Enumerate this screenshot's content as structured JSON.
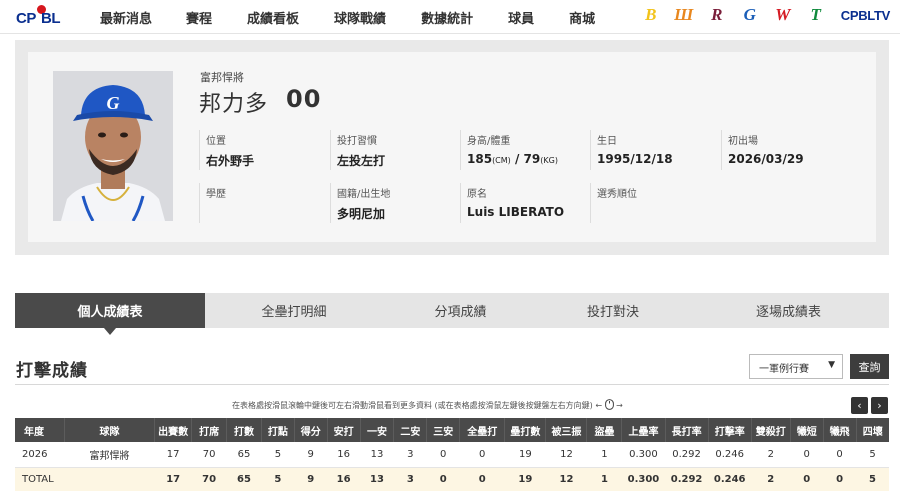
{
  "header": {
    "logo": {
      "cp": "CP",
      "bl": "BL"
    },
    "nav": [
      "最新消息",
      "賽程",
      "成績看板",
      "球隊戰績",
      "數據統計",
      "球員",
      "商城"
    ],
    "teams": [
      {
        "name": "brothers-logo",
        "glyph": "B",
        "color": "#f2c31a"
      },
      {
        "name": "lions-logo",
        "glyph": "Ш",
        "color": "#e8871e"
      },
      {
        "name": "rakuten-logo",
        "glyph": "R",
        "color": "#7a1e3a"
      },
      {
        "name": "fubon-logo",
        "glyph": "G",
        "color": "#1c5fb8"
      },
      {
        "name": "wei-chuan-logo",
        "glyph": "W",
        "color": "#d51b24"
      },
      {
        "name": "tsg-logo",
        "glyph": "T",
        "color": "#0f8a3c"
      }
    ],
    "tv_label": "CPBLTV"
  },
  "player": {
    "team": "富邦悍將",
    "name": "邦力多",
    "number": "00",
    "fields": [
      {
        "label": "位置",
        "value": "右外野手"
      },
      {
        "label": "投打習慣",
        "value": "左投左打"
      },
      {
        "label": "身高/體重",
        "value": "",
        "height": "185",
        "height_unit": "(CM)",
        "sep": " / ",
        "weight": "79",
        "weight_unit": "(KG)"
      },
      {
        "label": "生日",
        "value": "1995/12/18"
      },
      {
        "label": "初出場",
        "value": "2026/03/29"
      },
      {
        "label": "學歷",
        "value": ""
      },
      {
        "label": "國籍/出生地",
        "value": "多明尼加"
      },
      {
        "label": "原名",
        "value": "Luis LIBERATO"
      },
      {
        "label": "選秀順位",
        "value": ""
      }
    ]
  },
  "tabs": [
    "個人成績表",
    "全壘打明細",
    "分項成績",
    "投打對決",
    "逐場成績表"
  ],
  "section": {
    "title": "打擊成績",
    "select_value": "一軍例行賽",
    "query_label": "查詢",
    "hint": "在表格處按滑鼠滾輪中鍵後可左右滑動滑鼠看到更多資料 (或在表格處按滑鼠左鍵後按鍵盤左右方向鍵)",
    "pager_prev": "‹",
    "pager_next": "›"
  },
  "table": {
    "headers": [
      "年度",
      "球隊",
      "出賽數",
      "打席",
      "打數",
      "打點",
      "得分",
      "安打",
      "一安",
      "二安",
      "三安",
      "全壘打",
      "壘打數",
      "被三振",
      "盜壘",
      "上壘率",
      "長打率",
      "打擊率",
      "雙殺打",
      "犧短",
      "犧飛",
      "四壞"
    ],
    "rows": [
      [
        "2026",
        "富邦悍將",
        "17",
        "70",
        "65",
        "5",
        "9",
        "16",
        "13",
        "3",
        "0",
        "0",
        "19",
        "12",
        "1",
        "0.300",
        "0.292",
        "0.246",
        "2",
        "0",
        "0",
        "5"
      ]
    ],
    "total": [
      "TOTAL",
      "",
      "17",
      "70",
      "65",
      "5",
      "9",
      "16",
      "13",
      "3",
      "0",
      "0",
      "19",
      "12",
      "1",
      "0.300",
      "0.292",
      "0.246",
      "2",
      "0",
      "0",
      "5"
    ]
  }
}
